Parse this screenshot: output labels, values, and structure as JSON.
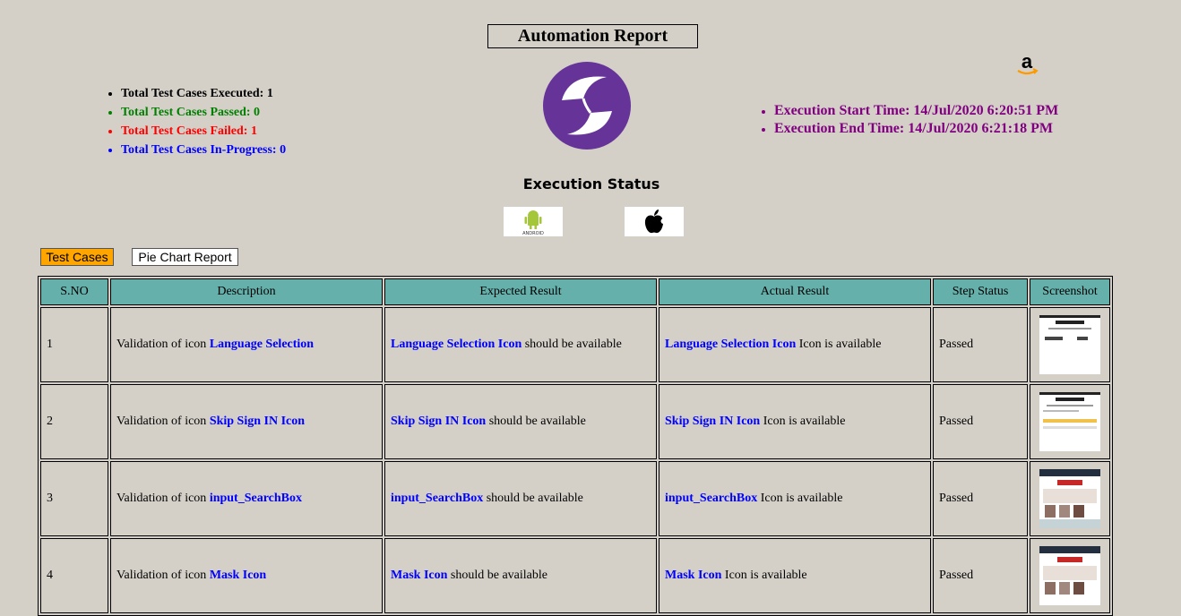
{
  "header": {
    "title": "Automation Report",
    "execution_status_heading": "Execution Status"
  },
  "summary": {
    "executed": "Total Test Cases Executed: 1",
    "passed": "Total Test Cases Passed: 0",
    "failed": "Total Test Cases Failed: 1",
    "in_progress": "Total Test Cases In-Progress: 0"
  },
  "times": {
    "start": "Execution Start Time: 14/Jul/2020 6:20:51 PM",
    "end": "Execution End Time: 14/Jul/2020 6:21:18 PM"
  },
  "platform_icons": [
    "android-icon",
    "apple-icon"
  ],
  "android_caption": "ANDROID",
  "tabs": {
    "test_cases": "Test Cases",
    "pie_chart": "Pie Chart Report"
  },
  "table": {
    "headers": [
      "S.NO",
      "Description",
      "Expected Result",
      "Actual Result",
      "Step Status",
      "Screenshot"
    ],
    "rows": [
      {
        "sno": "1",
        "desc_prefix": "Validation of icon ",
        "element": "Language Selection",
        "expected_suffix": " should be available",
        "actual_element": "Language Selection Icon",
        "expected_element": "Language Selection Icon",
        "actual_suffix": " Icon is available",
        "status": "Passed"
      },
      {
        "sno": "2",
        "desc_prefix": "Validation of icon ",
        "element": "Skip Sign IN Icon",
        "expected_suffix": " should be available",
        "actual_element": "Skip Sign IN Icon",
        "expected_element": "Skip Sign IN Icon",
        "actual_suffix": " Icon is available",
        "status": "Passed"
      },
      {
        "sno": "3",
        "desc_prefix": "Validation of icon ",
        "element": "input_SearchBox",
        "expected_suffix": " should be available",
        "actual_element": "input_SearchBox",
        "expected_element": "input_SearchBox",
        "actual_suffix": " Icon is available",
        "status": "Passed"
      },
      {
        "sno": "4",
        "desc_prefix": "Validation of icon ",
        "element": "Mask Icon",
        "expected_suffix": " should be available",
        "actual_element": "Mask Icon",
        "expected_element": "Mask Icon",
        "actual_suffix": " Icon is available",
        "status": "Passed"
      }
    ]
  },
  "colors": {
    "background": "#d4d0c8",
    "header_cell": "#66b0ab",
    "highlight": "#0000ff",
    "passed_text": "#008000",
    "failed_text": "#ff0000",
    "in_progress_text": "#0000ff",
    "time_text": "#800080",
    "active_tab": "#ffa500",
    "brand_purple": "#663399"
  }
}
